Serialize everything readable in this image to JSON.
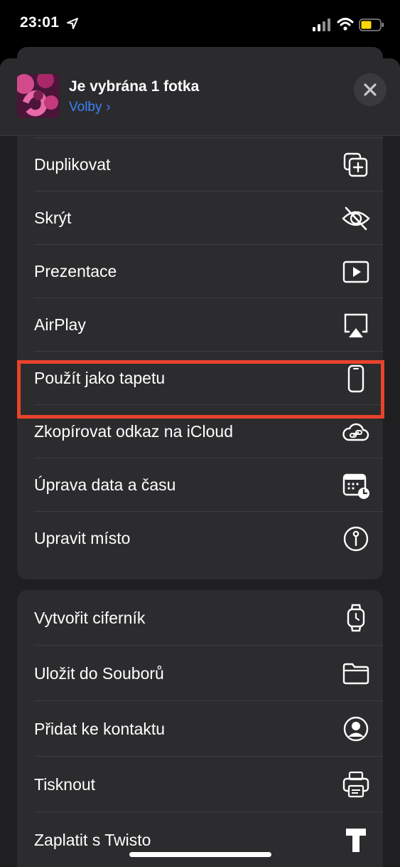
{
  "status_bar": {
    "time": "23:01"
  },
  "header": {
    "title": "Je vybrána 1 fotka",
    "options_label": "Volby",
    "chevron": "›"
  },
  "actions_group_1": [
    {
      "label": "Duplikovat",
      "icon": "duplicate-icon"
    },
    {
      "label": "Skrýt",
      "icon": "eye-slash-icon"
    },
    {
      "label": "Prezentace",
      "icon": "play-rectangle-icon"
    },
    {
      "label": "AirPlay",
      "icon": "airplay-icon"
    },
    {
      "label": "Použít jako tapetu",
      "icon": "iphone-icon",
      "highlighted": true
    },
    {
      "label": "Zkopírovat odkaz na iCloud",
      "icon": "cloud-link-icon"
    },
    {
      "label": "Úprava data a času",
      "icon": "calendar-clock-icon"
    },
    {
      "label": "Upravit místo",
      "icon": "location-info-icon"
    }
  ],
  "actions_group_2": [
    {
      "label": "Vytvořit ciferník",
      "icon": "watch-icon"
    },
    {
      "label": "Uložit do Souborů",
      "icon": "folder-icon"
    },
    {
      "label": "Přidat ke kontaktu",
      "icon": "person-circle-icon"
    },
    {
      "label": "Tisknout",
      "icon": "printer-icon"
    },
    {
      "label": "Zaplatit s Twisto",
      "icon": "twisto-t-icon"
    }
  ],
  "colors": {
    "highlight": "#e8432b",
    "link": "#3b82f6",
    "battery": "#ffd60a"
  }
}
